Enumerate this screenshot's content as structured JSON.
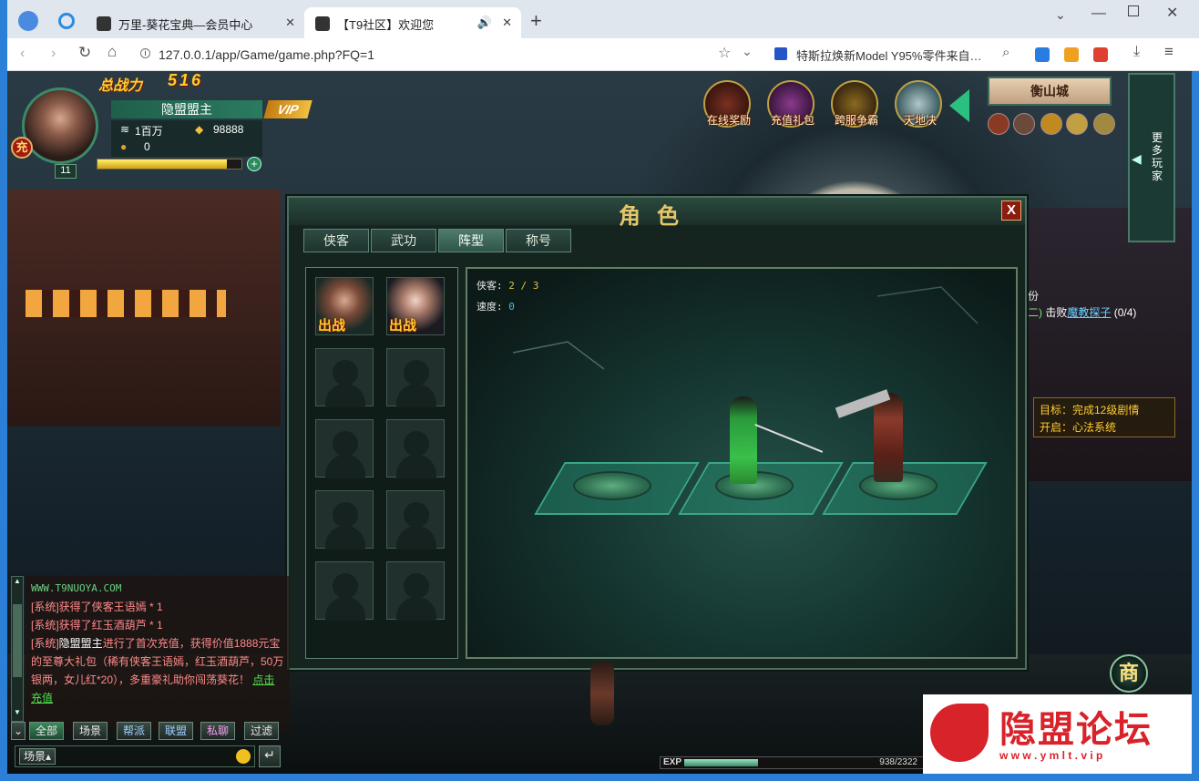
{
  "browser": {
    "tabs": [
      {
        "label": "万里-葵花宝典—会员中心"
      },
      {
        "label": "【T9社区】欢迎您"
      }
    ],
    "url": "127.0.0.1/app/Game/game.php?FQ=1",
    "search_suggestion": "特斯拉焕新Model Y95%零件来自…"
  },
  "hud": {
    "power_label": "总战力",
    "power_value": "516",
    "player_name": "隐盟盟主",
    "vip": "VIP",
    "silver": "1百万",
    "gold": "98888",
    "coins": "0",
    "level": "11",
    "recharge": "充",
    "city": "衡山城",
    "top_buttons": [
      "在线奖励",
      "充值礼包",
      "跨服争霸",
      "天地决"
    ],
    "sidebar_label": "更多玩家",
    "quest": {
      "kill": "击败",
      "target_npc": "魔教探子",
      "progress": "(0/4)",
      "part": "二)",
      "fen": "份"
    },
    "goal": "目标：完成12级剧情",
    "unlock": "开启：心法系统",
    "shop": "商",
    "exp_label": "EXP",
    "exp_value": "938/2322",
    "exp_fraction": 0.404
  },
  "panel": {
    "title": "角色",
    "tabs": [
      "侠客",
      "武功",
      "阵型",
      "称号"
    ],
    "active_tab": "阵型",
    "heroes_label": "侠客:",
    "heroes_value": "2 / 3",
    "speed_label": "速度:",
    "speed_value": "0",
    "deploy_label": "出战",
    "close": "X"
  },
  "chat": {
    "site": "WWW.T9NUOYA.COM",
    "lines": [
      "[系统]获得了侠客王语嫣 * 1",
      "[系统]获得了红玉酒葫芦 * 1"
    ],
    "line3_prefix": "[系统]",
    "line3_name": "隐盟盟主",
    "line3_text": "进行了首次充值，获得价值1888元宝的至尊大礼包（稀有侠客王语嫣，红玉酒葫芦，50万银两，女儿红*20），多重豪礼助你闯荡葵花！",
    "line3_link": "点击充值",
    "channels": [
      "全部",
      "场景",
      "帮派",
      "联盟",
      "私聊",
      "过滤"
    ],
    "input_channel": "场景"
  },
  "watermark": {
    "name": "隐盟论坛",
    "url": "w w w . y m l t . v i p"
  }
}
